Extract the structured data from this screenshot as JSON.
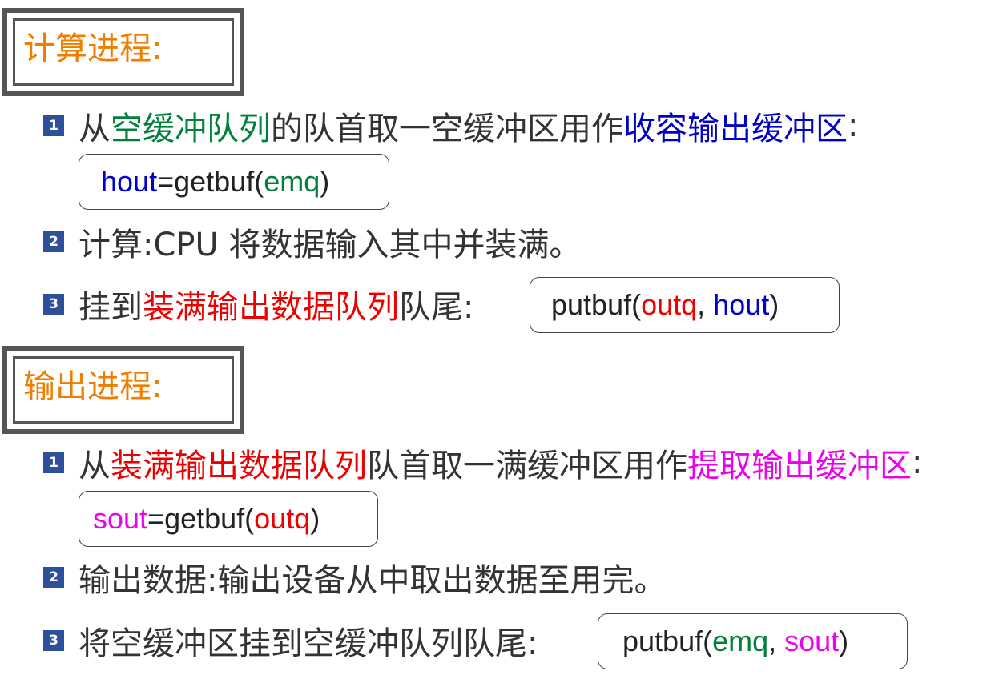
{
  "compute": {
    "title": "计算进程:",
    "step1": {
      "num": "1",
      "t1": "从",
      "t2": "空缓冲队列",
      "t3": "的队首取一空缓冲区用作",
      "t4": "收容输出缓冲区",
      "t5": ":",
      "code": {
        "c1": "hout",
        "c2": "=getbuf(",
        "c3": "emq",
        "c4": ")"
      }
    },
    "step2": {
      "num": "2",
      "text": "计算:CPU 将数据输入其中并装满。"
    },
    "step3": {
      "num": "3",
      "t1": "挂到",
      "t2": "装满输出数据队列",
      "t3": "队尾:",
      "code": {
        "c1": "putbuf(",
        "c2": "outq",
        "c3": ", ",
        "c4": "hout",
        "c5": ")"
      }
    }
  },
  "output": {
    "title": "输出进程:",
    "step1": {
      "num": "1",
      "t1": "从",
      "t2": "装满输出数据队列",
      "t3": "队首取一满缓冲区用作",
      "t4": "提取输出缓冲区",
      "t5": ":",
      "code": {
        "c1": "sout",
        "c2": "=getbuf(",
        "c3": "outq",
        "c4": ")"
      }
    },
    "step2": {
      "num": "2",
      "text": "输出数据:输出设备从中取出数据至用完。"
    },
    "step3": {
      "num": "3",
      "t1": "将空缓冲区挂到空缓冲队列队尾:",
      "code": {
        "c1": "putbuf(",
        "c2": "emq",
        "c3": ", ",
        "c4": "sout",
        "c5": ")"
      }
    }
  },
  "colors": {
    "title": "#f07d00",
    "blue": "#0000cc",
    "green": "#00803a",
    "red": "#ee0000",
    "magenta": "#ee00ee",
    "badge": "#2e4f9a"
  }
}
